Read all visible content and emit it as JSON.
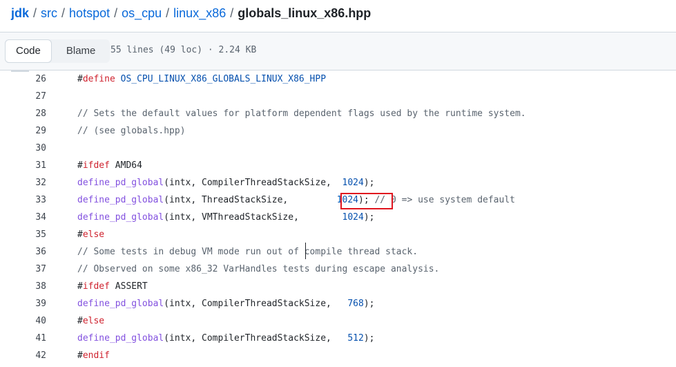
{
  "breadcrumb": {
    "parts": [
      "jdk",
      "src",
      "hotspot",
      "os_cpu",
      "linux_x86"
    ],
    "separator": "/",
    "current": "globals_linux_x86.hpp"
  },
  "toolbar": {
    "code_label": "Code",
    "blame_label": "Blame",
    "file_info": "55 lines (49 loc) · 2.24 KB"
  },
  "code": {
    "lines": [
      {
        "n": "26",
        "text": "#define OS_CPU_LINUX_X86_GLOBALS_LINUX_X86_HPP"
      },
      {
        "n": "27",
        "text": ""
      },
      {
        "n": "28",
        "text": "// Sets the default values for platform dependent flags used by the runtime system."
      },
      {
        "n": "29",
        "text": "// (see globals.hpp)"
      },
      {
        "n": "30",
        "text": ""
      },
      {
        "n": "31",
        "text": "#ifdef AMD64"
      },
      {
        "n": "32",
        "text": "define_pd_global(intx, CompilerThreadStackSize,  1024);"
      },
      {
        "n": "33",
        "text": "define_pd_global(intx, ThreadStackSize,         1024); // 0 => use system default"
      },
      {
        "n": "34",
        "text": "define_pd_global(intx, VMThreadStackSize,        1024);"
      },
      {
        "n": "35",
        "text": "#else"
      },
      {
        "n": "36",
        "text": "// Some tests in debug VM mode run out of compile thread stack."
      },
      {
        "n": "37",
        "text": "// Observed on some x86_32 VarHandles tests during escape analysis."
      },
      {
        "n": "38",
        "text": "#ifdef ASSERT"
      },
      {
        "n": "39",
        "text": "define_pd_global(intx, CompilerThreadStackSize,   768);"
      },
      {
        "n": "40",
        "text": "#else"
      },
      {
        "n": "41",
        "text": "define_pd_global(intx, CompilerThreadStackSize,   512);"
      },
      {
        "n": "42",
        "text": "#endif"
      }
    ]
  },
  "colors": {
    "link": "#0969da",
    "keyword": "#cf222e",
    "function": "#8250df",
    "comment": "#59636e",
    "number": "#0550ae",
    "highlight_box": "#e0141e"
  }
}
